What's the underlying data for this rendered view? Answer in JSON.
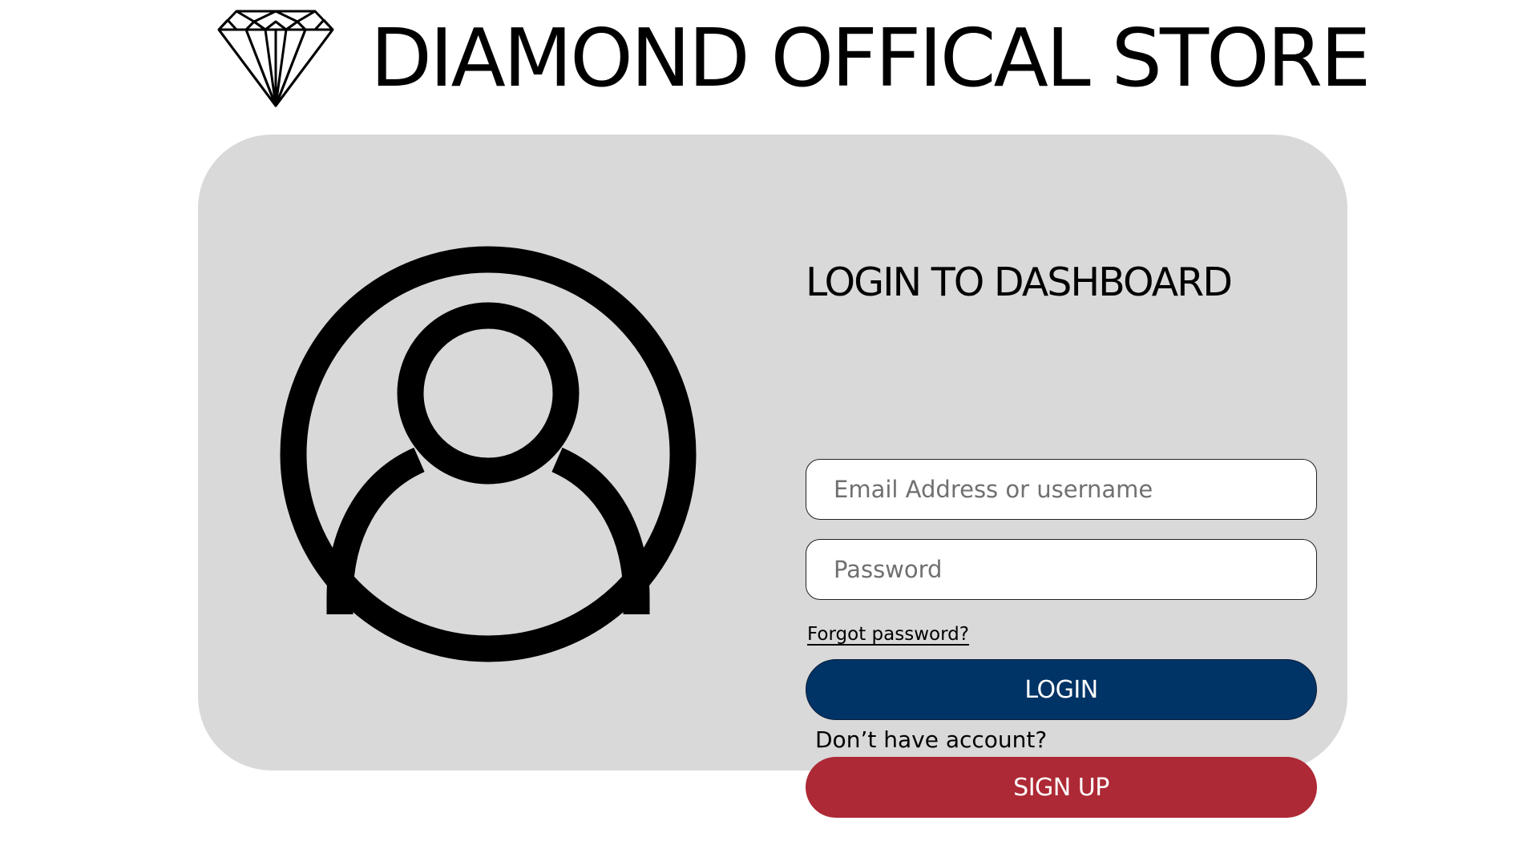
{
  "header": {
    "logo_icon": "diamond-icon",
    "title": "DIAMOND OFFICAL STORE"
  },
  "login_card": {
    "avatar_icon": "user-circle-icon",
    "title": "LOGIN TO DASHBOARD",
    "email_field": {
      "placeholder": "Email Address or username",
      "value": ""
    },
    "password_field": {
      "placeholder": "Password",
      "value": ""
    },
    "forgot_password_label": "Forgot password?",
    "login_button_label": "LOGIN",
    "no_account_text": "Don’t have account?",
    "signup_button_label": "SIGN UP"
  },
  "colors": {
    "card_background": "#d9d9d9",
    "login_button": "#003366",
    "signup_button": "#ad2935"
  }
}
